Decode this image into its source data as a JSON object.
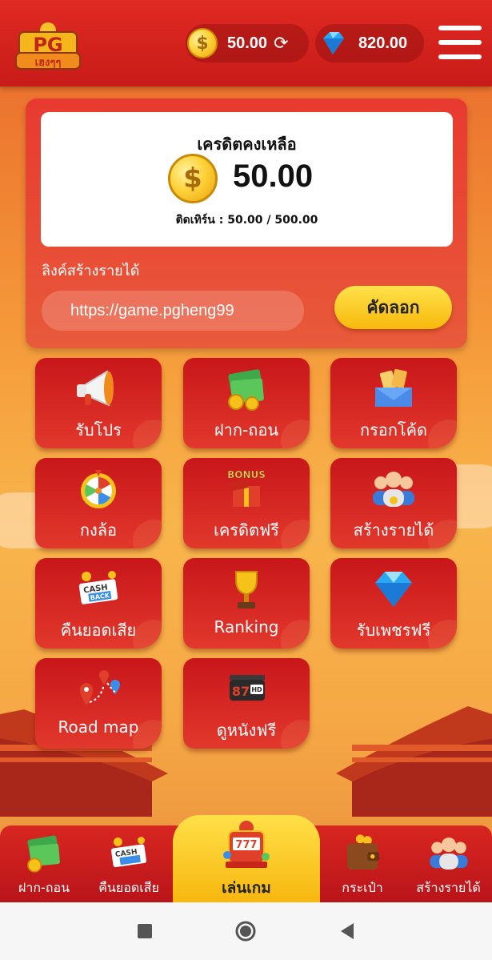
{
  "header": {
    "logo_text": "PG เฮงๆๆ",
    "credit_balance": "50.00",
    "gem_balance": "820.00",
    "icons": [
      "coin-icon",
      "refresh-icon",
      "diamond-icon",
      "hamburger-menu-icon"
    ]
  },
  "credit_panel": {
    "title": "เครดิตคงเหลือ",
    "amount": "50.00",
    "turnover": "ติดเทิร์น : 50.00 / 500.00",
    "link_label": "ลิงค์สร้างรายได้",
    "link_value": "https://game.pgheng99",
    "copy_label": "คัดลอก"
  },
  "menu": [
    {
      "label": "รับโปร",
      "icon": "megaphone-icon"
    },
    {
      "label": "ฝาก-ถอน",
      "icon": "money-icon"
    },
    {
      "label": "กรอกโค้ด",
      "icon": "coupon-icon"
    },
    {
      "label": "กงล้อ",
      "icon": "wheel-icon"
    },
    {
      "label": "เครดิตฟรี",
      "icon": "bonus-box-icon"
    },
    {
      "label": "สร้างรายได้",
      "icon": "team-icon"
    },
    {
      "label": "คืนยอดเสีย",
      "icon": "cashback-icon"
    },
    {
      "label": "Ranking",
      "icon": "trophy-icon"
    },
    {
      "label": "รับเพชรฟรี",
      "icon": "diamond-icon"
    },
    {
      "label": "Road map",
      "icon": "map-pin-icon"
    },
    {
      "label": "ดูหนังฟรี",
      "icon": "movie-icon"
    }
  ],
  "bottom_nav": [
    {
      "label": "ฝาก-ถอน",
      "icon": "money-icon"
    },
    {
      "label": "คืนยอดเสีย",
      "icon": "cashback-icon"
    },
    {
      "label": "เล่นเกม",
      "icon": "slot-machine-icon",
      "active": true
    },
    {
      "label": "กระเป๋า",
      "icon": "wallet-icon"
    },
    {
      "label": "สร้างรายได้",
      "icon": "team-icon"
    }
  ],
  "colors": {
    "primary_red": "#d82620",
    "accent_yellow": "#f7b90c",
    "background_orange": "#f59a3a"
  }
}
